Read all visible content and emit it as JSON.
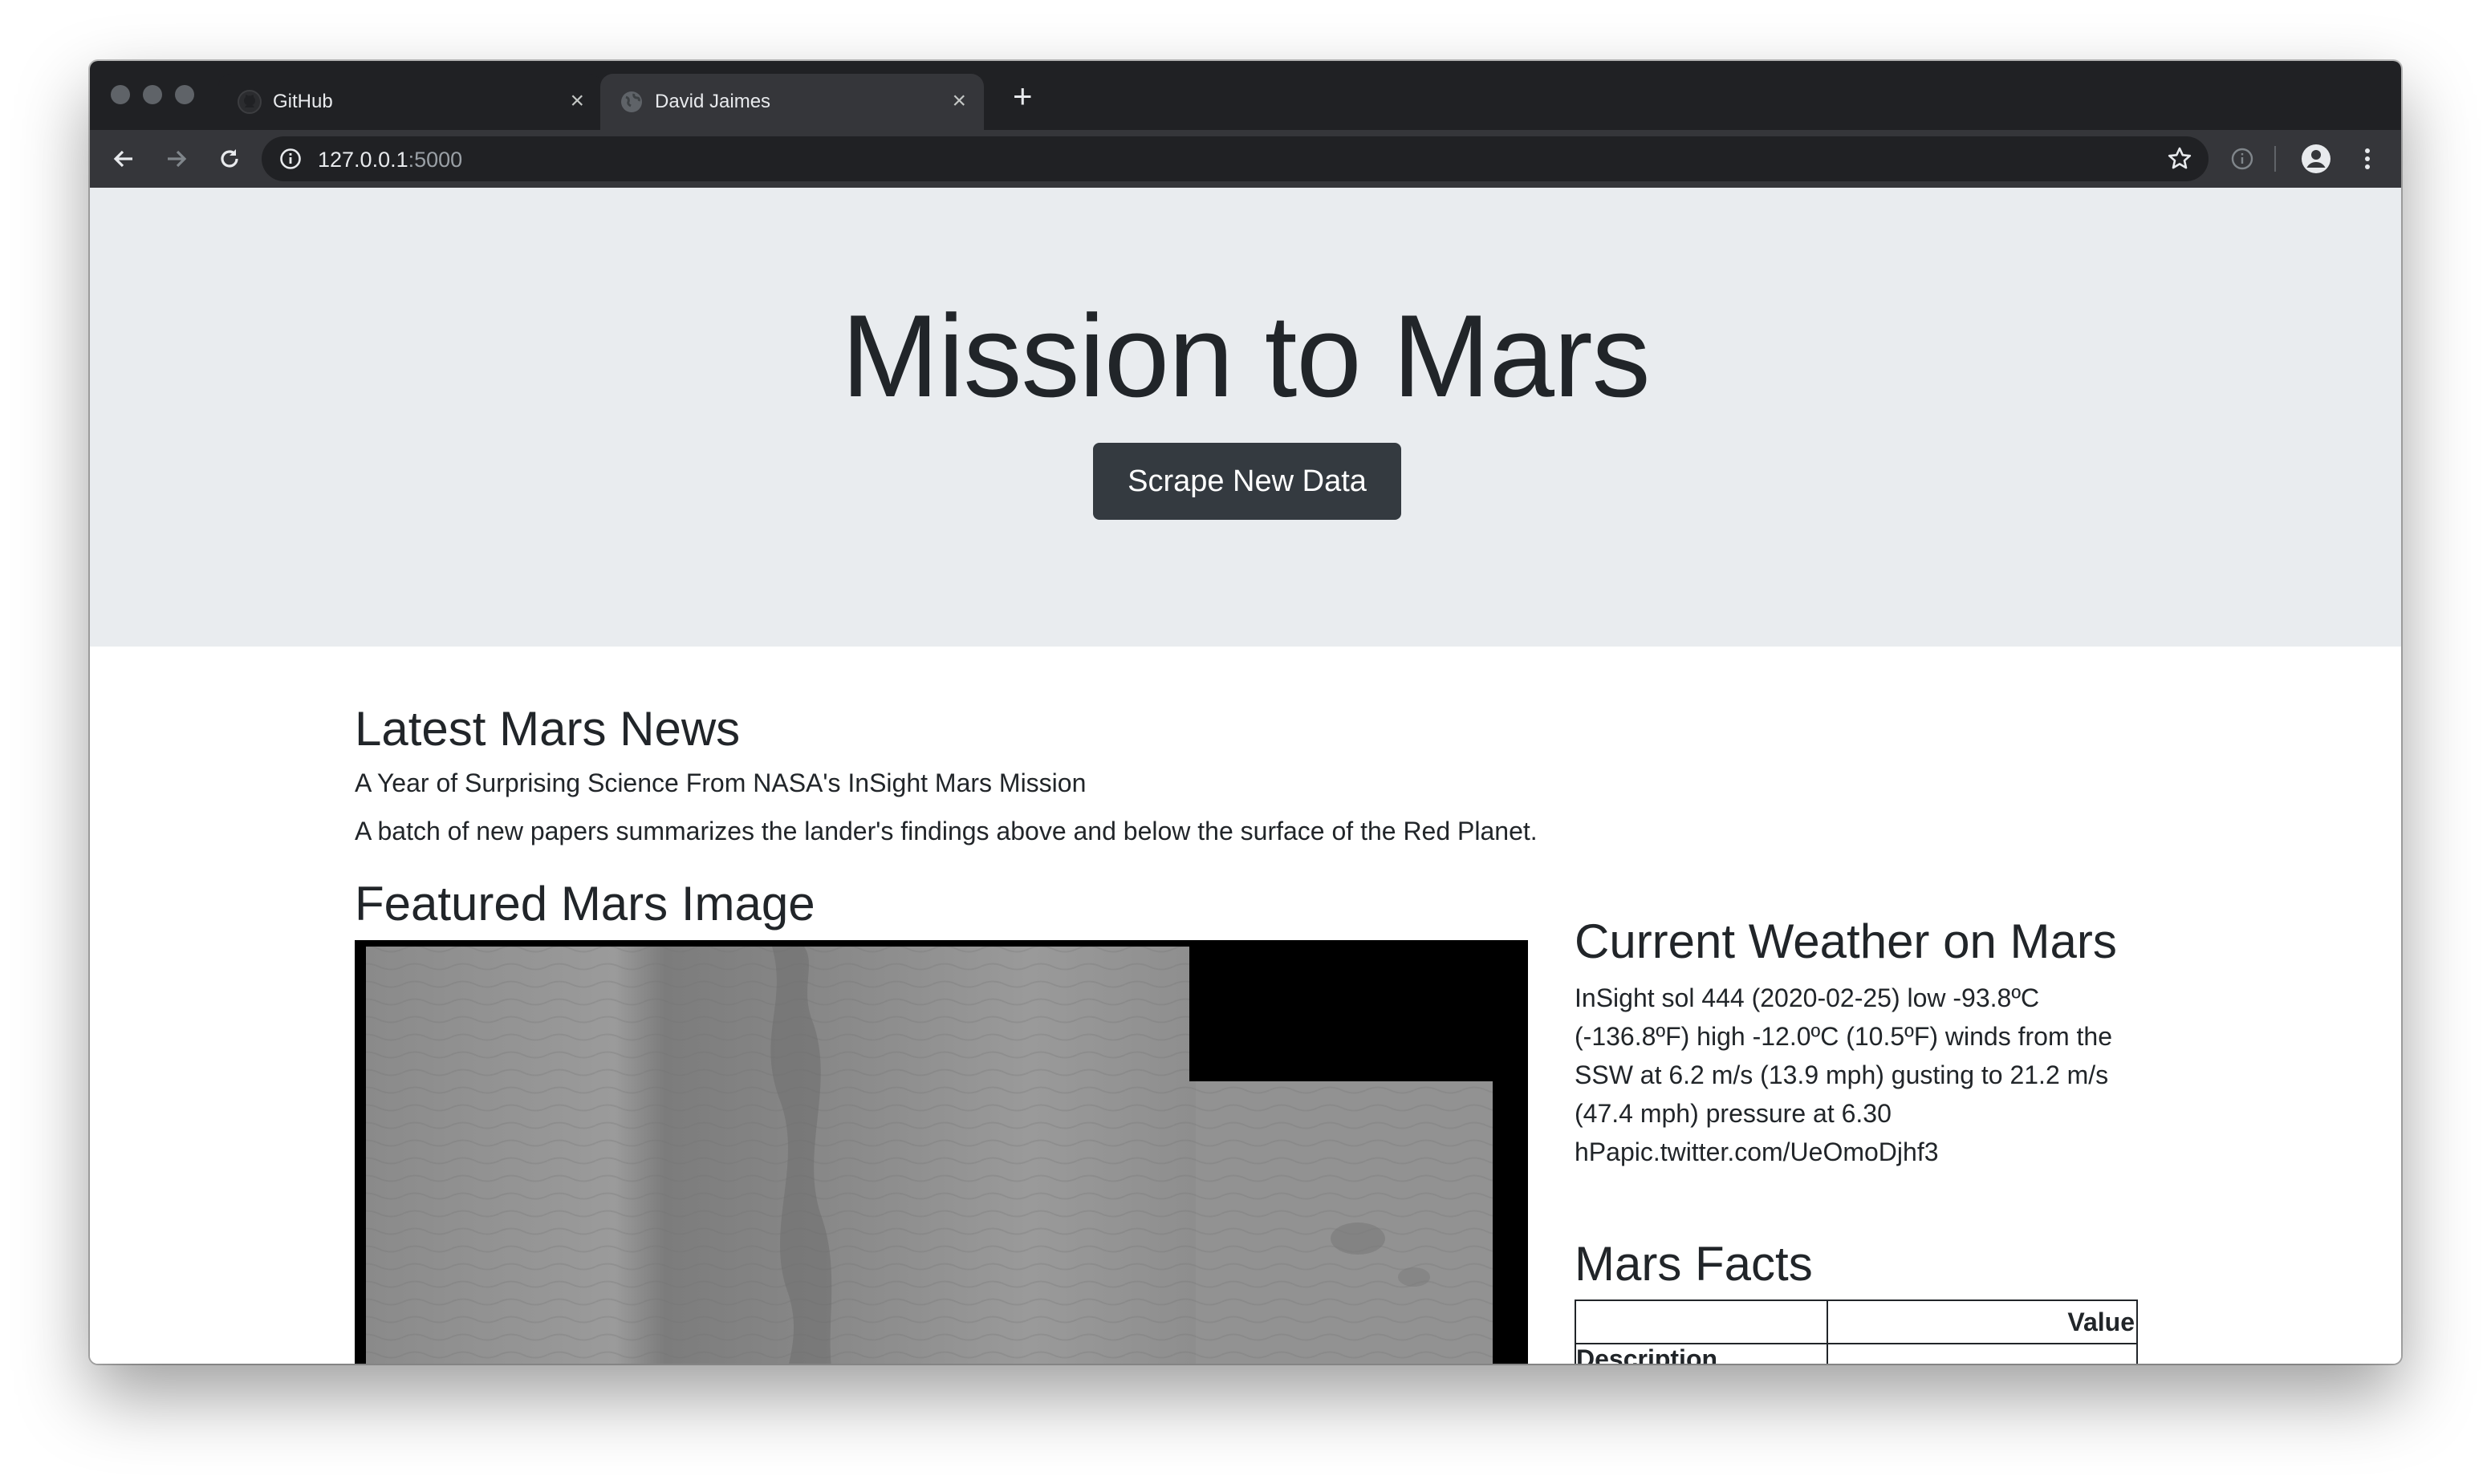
{
  "browser": {
    "tabs": [
      {
        "title": "GitHub",
        "icon": "github-icon",
        "active": false
      },
      {
        "title": "David Jaimes",
        "icon": "globe-icon",
        "active": true
      }
    ],
    "close_glyph": "×",
    "new_tab_glyph": "+",
    "address": {
      "host": "127.0.0.1",
      "port": ":5000"
    }
  },
  "page": {
    "title": "Mission to Mars",
    "scrape_button": "Scrape New Data",
    "news": {
      "heading": "Latest Mars News",
      "headline": "A Year of Surprising Science From NASA's InSight Mars Mission",
      "teaser": "A batch of new papers summarizes the lander's findings above and below the surface of the Red Planet."
    },
    "featured_image": {
      "heading": "Featured Mars Image"
    },
    "weather": {
      "heading": "Current Weather on Mars",
      "text": "InSight sol 444 (2020-02-25) low -93.8ºC (-136.8ºF) high -12.0ºC (10.5ºF) winds from the SSW at 6.2 m/s (13.9 mph) gusting to 21.2 m/s (47.4 mph) pressure at 6.30 hPapic.twitter.com/UeOmoDjhf3"
    },
    "facts": {
      "heading": "Mars Facts",
      "header_col1": "",
      "header_col2": "Value",
      "row_header": "Description"
    }
  },
  "colors": {
    "jumbotron_bg": "#e9ecef",
    "button_bg": "#343a40",
    "text": "#212529",
    "browser_frame": "#202124",
    "toolbar": "#35363a"
  }
}
